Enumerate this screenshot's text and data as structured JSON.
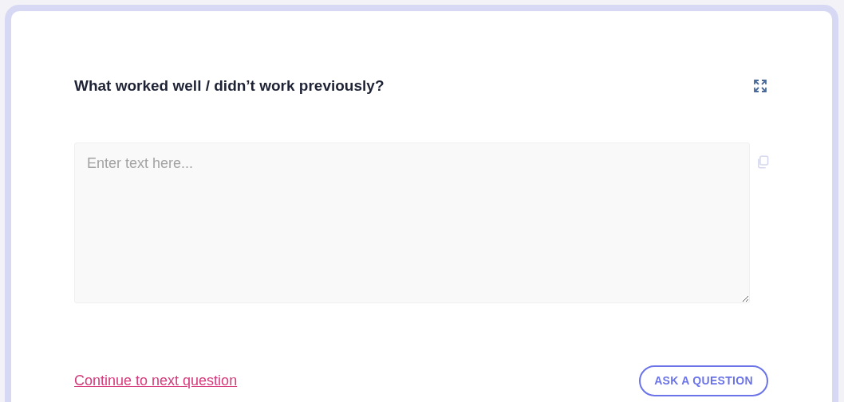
{
  "question": {
    "title": "What worked well / didn’t work previously?"
  },
  "answer": {
    "placeholder": "Enter text here..."
  },
  "footer": {
    "link": "Continue to next question",
    "button": "ASK A QUESTION"
  }
}
